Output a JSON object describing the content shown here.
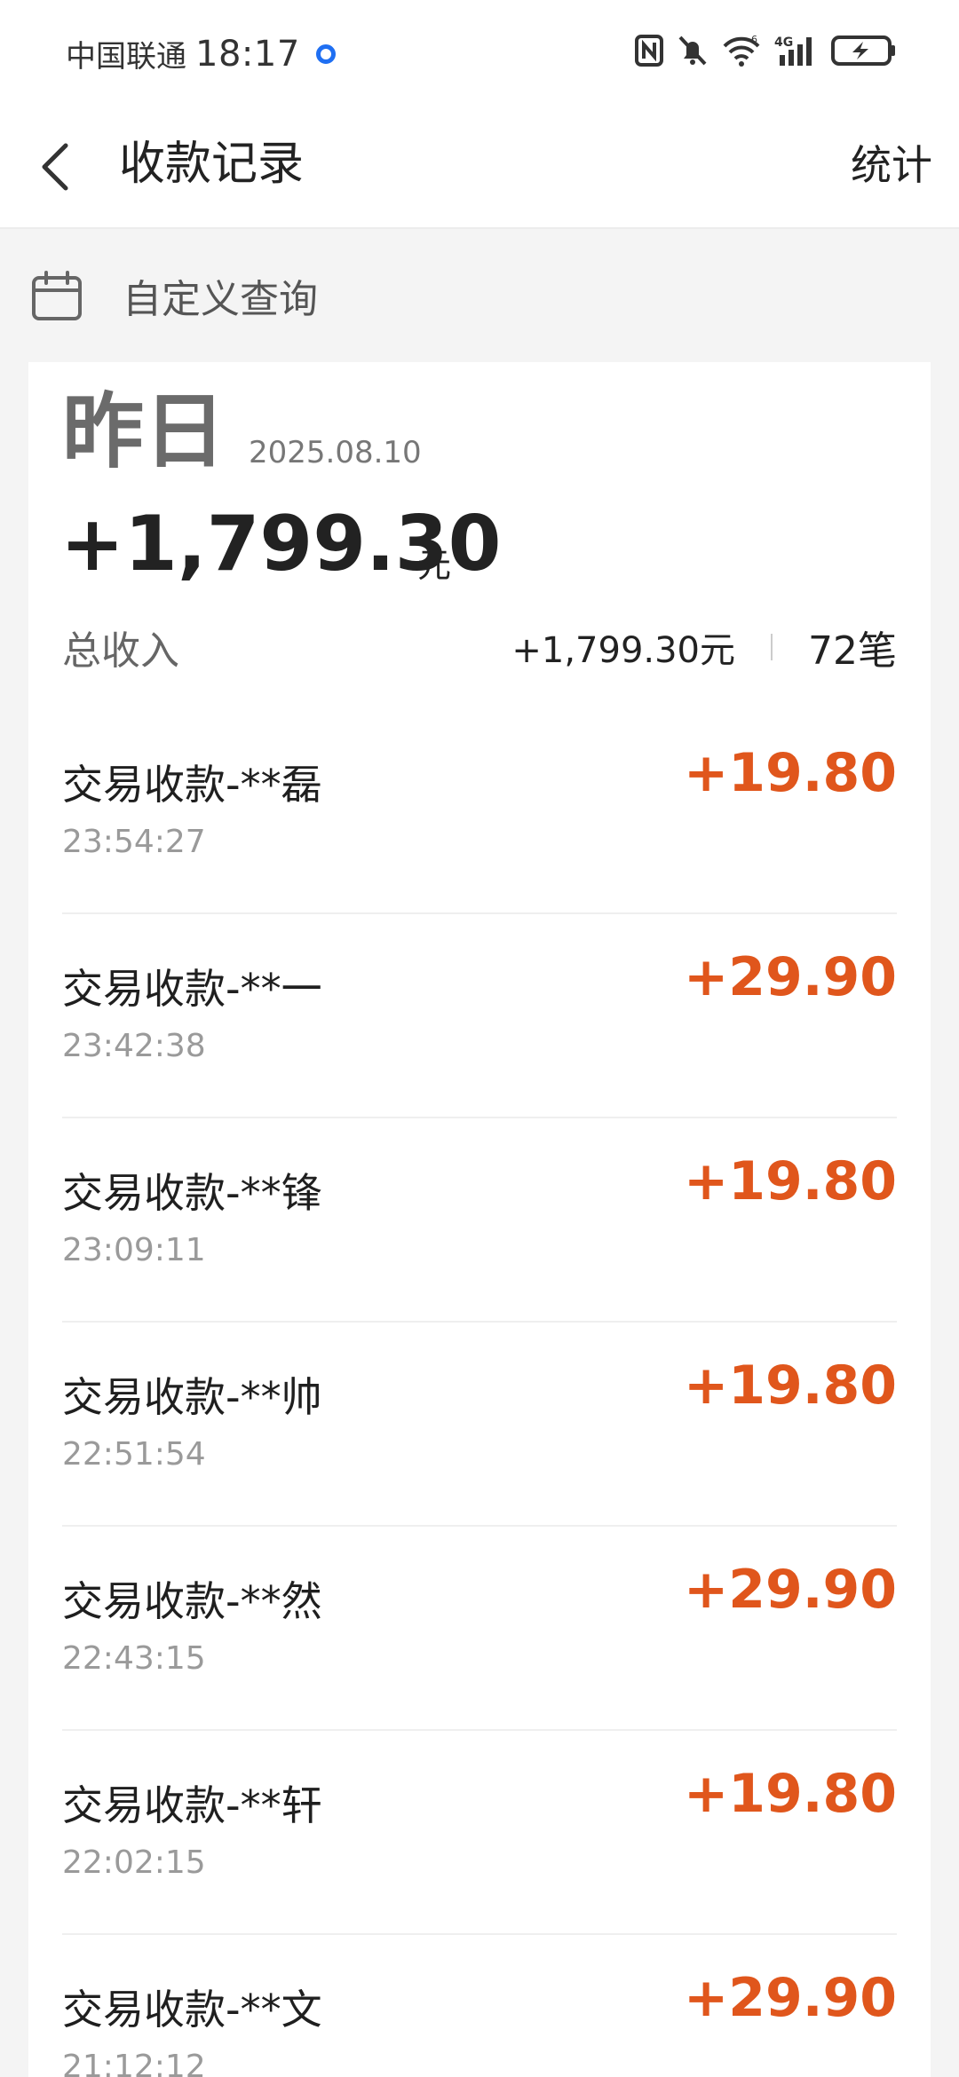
{
  "status_bar": {
    "carrier": "中国联通",
    "time": "18:17",
    "network": "4G",
    "wifi_badge": "6"
  },
  "nav": {
    "title": "收款记录",
    "action": "统计"
  },
  "query": {
    "label": "自定义查询"
  },
  "summary": {
    "day_label": "昨日",
    "date": "2025.08.10",
    "amount": "+1,799.30",
    "unit": "元",
    "total_label": "总收入",
    "total_value": "+1,799.30元",
    "count": "72笔"
  },
  "transactions": [
    {
      "name": "交易收款-**磊",
      "time": "23:54:27",
      "amount": "+19.80"
    },
    {
      "name": "交易收款-**一",
      "time": "23:42:38",
      "amount": "+29.90"
    },
    {
      "name": "交易收款-**锋",
      "time": "23:09:11",
      "amount": "+19.80"
    },
    {
      "name": "交易收款-**帅",
      "time": "22:51:54",
      "amount": "+19.80"
    },
    {
      "name": "交易收款-**然",
      "time": "22:43:15",
      "amount": "+29.90"
    },
    {
      "name": "交易收款-**轩",
      "time": "22:02:15",
      "amount": "+19.80"
    },
    {
      "name": "交易收款-**文",
      "time": "21:12:12",
      "amount": "+29.90"
    }
  ],
  "colors": {
    "amount_accent": "#e0561c",
    "location_dot": "#1f6ff2"
  }
}
